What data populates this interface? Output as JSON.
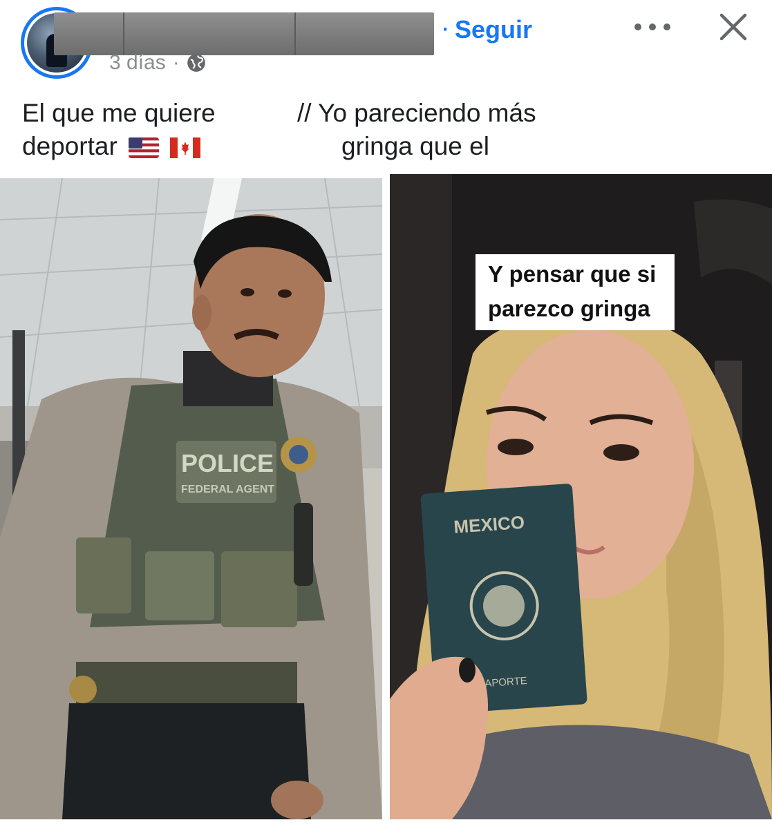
{
  "post": {
    "timestamp": "3 días",
    "separator": "·",
    "follow_label": "Seguir",
    "follow_dot": "·"
  },
  "caption": {
    "left_line1": "El que me quiere",
    "left_line2": "deportar",
    "right_line1": "//  Yo pareciendo más",
    "right_line2": "gringa que el",
    "flags": [
      "us-flag-emoji",
      "canada-flag-emoji"
    ]
  },
  "left_image": {
    "vest_patch_line1": "POLICE",
    "vest_patch_line2": "FEDERAL AGENT"
  },
  "right_image": {
    "overlay_line1": "Y pensar que si",
    "overlay_line2": "parezco gringa",
    "passport_title": "MEXICO",
    "passport_subtitle": "PASAPORTE"
  },
  "icons": {
    "globe": "globe-icon",
    "more": "more-horizontal-icon",
    "close": "close-icon"
  },
  "colors": {
    "accent": "#1877f2",
    "text": "#1c1e21",
    "muted": "#8a8d91",
    "redaction": "#7c7c7c"
  }
}
